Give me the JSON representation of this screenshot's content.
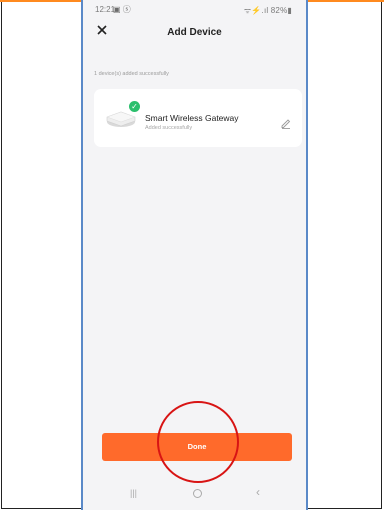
{
  "status_bar": {
    "time": "12:21",
    "icons_left": "▣ ⓢ",
    "right": "ᯤ⚡.ıl 82%▮"
  },
  "header": {
    "close_icon": "close-icon",
    "title": "Add Device"
  },
  "success_note": "1 device(s) added successfully",
  "device": {
    "name": "Smart Wireless Gateway",
    "status": "Added successfully",
    "badge_color": "#2bbf6d",
    "check_glyph": "✓"
  },
  "done_button": {
    "label": "Done",
    "color": "#ff6a2b"
  },
  "nav": {
    "recent": "|||",
    "back": "‹"
  },
  "annotation": {
    "color": "#d81414"
  }
}
